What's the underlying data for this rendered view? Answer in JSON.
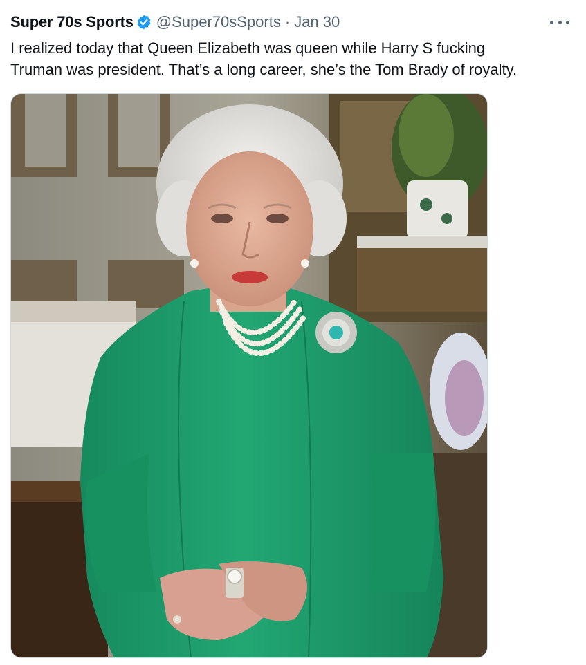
{
  "tweet": {
    "display_name": "Super 70s Sports",
    "handle": "@Super70sSports",
    "separator": "·",
    "date": "Jan 30",
    "text_lines": [
      "I realized today that Queen Elizabeth was queen while Harry S fucking",
      "Truman was president. That’s a long career, she’s the Tom Brady of royalty."
    ]
  },
  "icons": {
    "verified": "verified-badge-icon",
    "more": "more-horizontal-icon"
  },
  "colors": {
    "text": "#0f1419",
    "secondary": "#536471",
    "verified_blue": "#1d9bf0",
    "border": "#cfd9de",
    "dress_green": "#1f9a6c"
  }
}
